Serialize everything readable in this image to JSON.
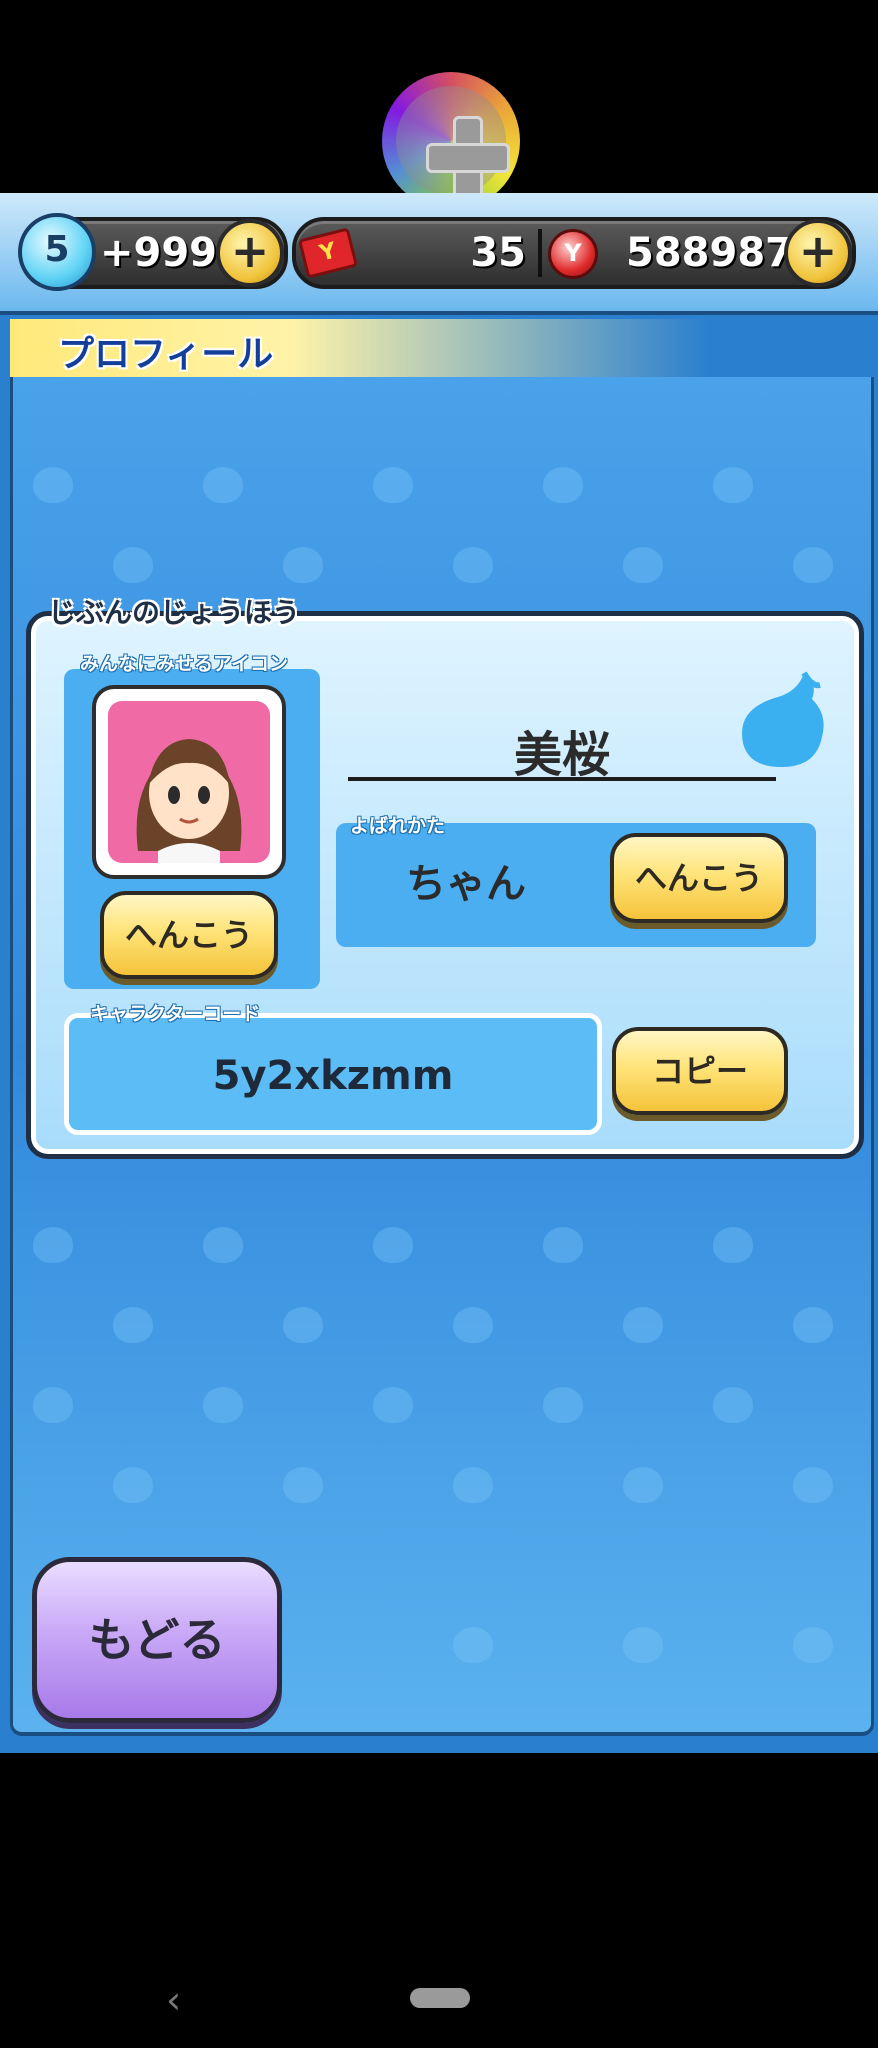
{
  "topbar": {
    "medal_level": "5",
    "medal_count": "+999",
    "ticket_count": "35",
    "money": "588987",
    "plus_symbol": "+"
  },
  "screen": {
    "title": "プロフィール"
  },
  "profile_panel": {
    "label": "じぶんのじょうほう",
    "icon_section_label": "みんなにみせるアイコン",
    "change_icon_button": "へんこう",
    "player_name": "美桜",
    "title_section_label": "よばれかた",
    "title_value": "ちゃん",
    "change_title_button": "へんこう",
    "code_section_label": "キャラクターコード",
    "character_code": "5y2xkzmm",
    "copy_button": "コピー"
  },
  "footer": {
    "back_button": "もどる"
  },
  "icons": {
    "gamepad": "gamepad-icon",
    "medal": "yokai-medal-icon",
    "ticket": "ticket-icon",
    "coin": "money-purse-icon",
    "drop": "yokai-drop-icon",
    "avatar": "girl-avatar-icon"
  },
  "colors": {
    "background_blue": "#3289dc",
    "banner_yellow": "#ffe97a",
    "button_yellow": "#f5c33a",
    "back_button_purple": "#c9a9f7",
    "avatar_pink": "#f06aa6"
  }
}
